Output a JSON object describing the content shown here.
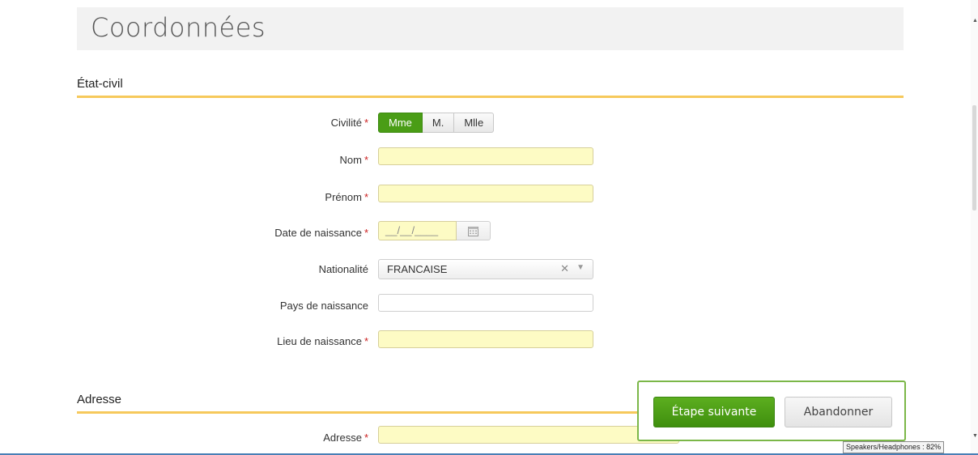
{
  "page": {
    "title": "Coordonnées"
  },
  "sections": {
    "etat_civil": "État-civil",
    "adresse": "Adresse"
  },
  "form": {
    "civilite": {
      "label": "Civilité",
      "options": [
        "Mme",
        "M.",
        "Mlle"
      ],
      "selected": "Mme"
    },
    "nom": {
      "label": "Nom",
      "value": ""
    },
    "prenom": {
      "label": "Prénom",
      "value": ""
    },
    "date_naissance": {
      "label": "Date de naissance",
      "mask": "__/__/____"
    },
    "nationalite": {
      "label": "Nationalité",
      "value": "FRANCAISE"
    },
    "pays_naissance": {
      "label": "Pays de naissance",
      "value": ""
    },
    "lieu_naissance": {
      "label": "Lieu de naissance",
      "value": ""
    },
    "adresse": {
      "label": "Adresse",
      "value": ""
    },
    "required_marker": "*"
  },
  "actions": {
    "next": "Étape suivante",
    "cancel": "Abandonner"
  },
  "tooltip": "Speakers/Headphones : 82%",
  "icons": {
    "calendar": "calendar-icon",
    "clear": "close-icon",
    "dropdown": "chevron-down-icon"
  },
  "colors": {
    "accent_green": "#4a9d16",
    "section_line": "#f6c95b",
    "required_field": "#fdfbc4",
    "required_marker": "#cc2222"
  }
}
